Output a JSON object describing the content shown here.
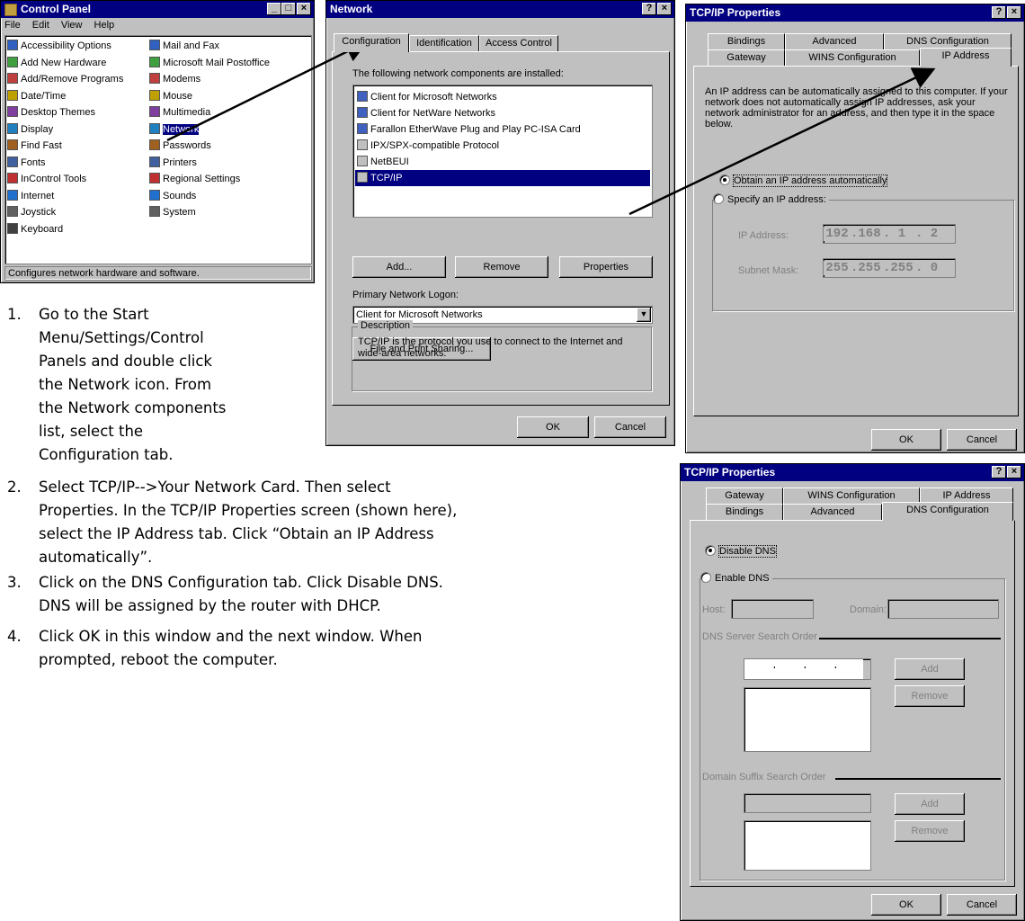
{
  "control_panel": {
    "title": "Control Panel",
    "menu": [
      "File",
      "Edit",
      "View",
      "Help"
    ],
    "items_left": [
      "Accessibility Options",
      "Add New Hardware",
      "Add/Remove Programs",
      "Date/Time",
      "Desktop Themes",
      "Display",
      "Find Fast",
      "Fonts",
      "InControl Tools",
      "Internet",
      "Joystick",
      "Keyboard"
    ],
    "items_right": [
      "Mail and Fax",
      "Microsoft Mail Postoffice",
      "Modems",
      "Mouse",
      "Multimedia",
      "Network",
      "Passwords",
      "Printers",
      "Regional Settings",
      "Sounds",
      "System"
    ],
    "status": "Configures network hardware and software."
  },
  "network": {
    "title": "Network",
    "tabs": [
      "Configuration",
      "Identification",
      "Access Control"
    ],
    "components_label": "The following network components are installed:",
    "components": [
      "Client for Microsoft Networks",
      "Client for NetWare Networks",
      "Farallon EtherWave Plug and Play PC-ISA Card",
      "IPX/SPX-compatible Protocol",
      "NetBEUI",
      "TCP/IP"
    ],
    "add": "Add...",
    "remove": "Remove",
    "properties": "Properties",
    "logon_label": "Primary Network Logon:",
    "logon_value": "Client for Microsoft Networks",
    "file_print": "File and Print Sharing...",
    "desc_label": "Description",
    "desc_text": "TCP/IP is the protocol you use to connect to the Internet and wide-area networks.",
    "ok": "OK",
    "cancel": "Cancel"
  },
  "tcpip1": {
    "title": "TCP/IP Properties",
    "tabs_top": [
      "Bindings",
      "Advanced",
      "DNS Configuration"
    ],
    "tabs_bottom": [
      "Gateway",
      "WINS Configuration",
      "IP Address"
    ],
    "info": "An IP address can be automatically assigned to this computer. If your network does not automatically assign IP addresses, ask your network administrator for an address, and then type it in the space below.",
    "obtain": "Obtain an IP address automatically",
    "specify": "Specify an IP address:",
    "ip_label": "IP Address:",
    "ip": [
      "192",
      "168",
      "1",
      "2"
    ],
    "mask_label": "Subnet Mask:",
    "mask": [
      "255",
      "255",
      "255",
      "0"
    ],
    "ok": "OK",
    "cancel": "Cancel"
  },
  "tcpip2": {
    "title": "TCP/IP Properties",
    "tabs_top": [
      "Gateway",
      "WINS Configuration",
      "IP Address"
    ],
    "tabs_bottom": [
      "Bindings",
      "Advanced",
      "DNS Configuration"
    ],
    "disable": "Disable DNS",
    "enable": "Enable DNS",
    "host": "Host:",
    "domain": "Domain:",
    "server_order": "DNS Server Search Order",
    "suffix_order": "Domain Suffix Search Order",
    "add": "Add",
    "remove": "Remove",
    "ok": "OK",
    "cancel": "Cancel"
  },
  "steps": [
    {
      "n": "1.",
      "lines": [
        "Go to the Start",
        "Menu/Settings/Control",
        "Panels and double click",
        "the Network icon. From",
        "the Network components",
        "list, select the",
        "Configuration tab."
      ]
    },
    {
      "n": "2.",
      "lines": [
        "Select TCP/IP-->Your Network Card. Then select",
        "Properties. In the TCP/IP Properties screen (shown here),",
        "select the IP Address tab. Click “Obtain an IP Address",
        "automatically”."
      ]
    },
    {
      "n": "3.",
      "lines": [
        "Click on the DNS Configuration tab. Click Disable DNS.",
        "DNS will be assigned by the router with DHCP."
      ]
    },
    {
      "n": "4.",
      "lines": [
        "Click OK in this window and the next window. When",
        "prompted, reboot the computer."
      ]
    }
  ]
}
